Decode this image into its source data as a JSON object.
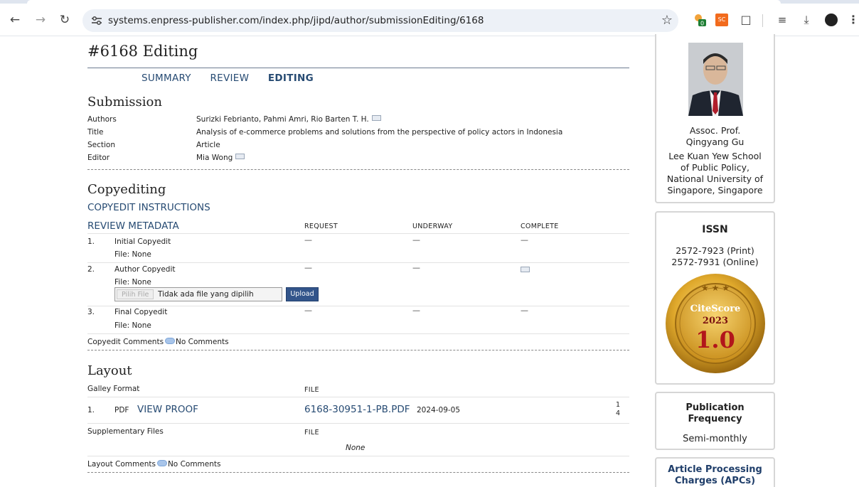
{
  "browser": {
    "url": "systems.enpress-publisher.com/index.php/jipd/author/submissionEditing/6168",
    "ext_badge": "0",
    "ext_sc": "SC"
  },
  "page": {
    "title": "#6168 Editing",
    "tabs": [
      "SUMMARY",
      "REVIEW",
      "EDITING"
    ]
  },
  "submission": {
    "heading": "Submission",
    "rows": [
      {
        "label": "Authors",
        "value": "Surizki Febrianto, Pahmi Amri, Rio Barten T. H."
      },
      {
        "label": "Title",
        "value": "Analysis of e-commerce problems and solutions from the perspective of policy actors in Indonesia"
      },
      {
        "label": "Section",
        "value": "Article"
      },
      {
        "label": "Editor",
        "value": "Mia Wong"
      }
    ]
  },
  "copyediting": {
    "heading": "Copyediting",
    "instructions_link": "COPYEDIT INSTRUCTIONS",
    "metadata_link": "REVIEW METADATA",
    "col_request": "REQUEST",
    "col_underway": "UNDERWAY",
    "col_complete": "COMPLETE",
    "dash": "—",
    "steps": [
      {
        "num": "1.",
        "name": "Initial Copyedit",
        "file": "File: None"
      },
      {
        "num": "2.",
        "name": "Author Copyedit",
        "file": "File: None"
      },
      {
        "num": "3.",
        "name": "Final Copyedit",
        "file": "File: None"
      }
    ],
    "file_pick": "Pilih File",
    "file_none": "Tidak ada file yang dipilih",
    "upload": "Upload",
    "comments_label": "Copyedit Comments",
    "comments_value": "No Comments"
  },
  "layout": {
    "heading": "Layout",
    "galley_label": "Galley Format",
    "file_col": "FILE",
    "galley_num": "1.",
    "galley_type": "PDF",
    "view_proof": "VIEW PROOF",
    "galley_file": "6168-30951-1-PB.PDF",
    "galley_date": "2024-09-05",
    "galley_count_top": "1",
    "galley_count_bottom": "4",
    "supp_label": "Supplementary Files",
    "supp_none": "None",
    "comments_label": "Layout Comments",
    "comments_value": "No Comments"
  },
  "sidebar": {
    "editor_title": "Assoc. Prof.",
    "editor_name": "Qingyang Gu",
    "editor_affil": [
      "Lee Kuan Yew School",
      "of Public Policy,",
      "National University of",
      "Singapore, Singapore"
    ],
    "issn_heading": "ISSN",
    "issn_print": "2572-7923 (Print)",
    "issn_online": "2572-7931 (Online)",
    "citescore_label": "CiteScore",
    "citescore_year": "2023",
    "citescore_value": "1.0",
    "freq_heading_1": "Publication",
    "freq_heading_2": "Frequency",
    "freq_value": "Semi-monthly",
    "apc_heading_1": "Article Processing",
    "apc_heading_2": "Charges (APCs)"
  }
}
